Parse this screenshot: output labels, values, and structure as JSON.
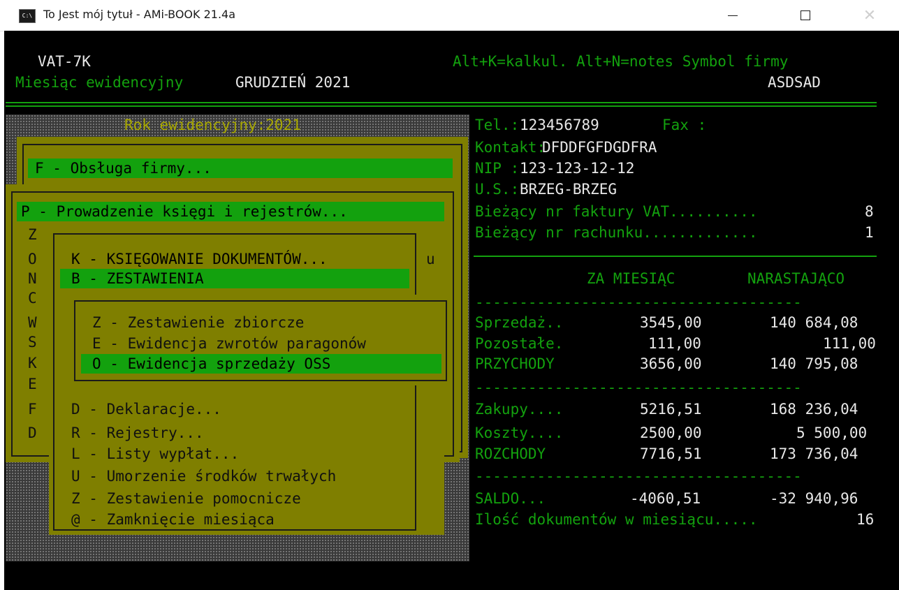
{
  "window": {
    "icon_label": "C:\\",
    "title": "To Jest mój tytuł - AMi-BOOK 21.4a"
  },
  "header": {
    "form": "VAT-7K",
    "hint": "Alt+K=kalkul. Alt+N=notes Symbol firmy",
    "month_label": "Miesiąc ewidencyjny",
    "month_value": "GRUDZIEŃ 2021",
    "symbol": "ASDSAD"
  },
  "year_label": "Rok ewidencyjny:2021",
  "info": {
    "tel_label": "Tel.:",
    "tel_value": "123456789",
    "fax_label": "Fax :",
    "contact_label": "Kontakt:",
    "contact_value": "DFDDFGFDGDFRA",
    "nip_label": "NIP :",
    "nip_value": "123-123-12-12",
    "us_label": "U.S.:",
    "us_value": "BRZEG-BRZEG",
    "invoice_label": "Bieżący nr faktury VAT..........",
    "invoice_value": "8",
    "bill_label": "Bieżący nr rachunku.............",
    "bill_value": "1"
  },
  "summary": {
    "col_month": "ZA MIESIĄC",
    "col_cumulative": "NARASTAJĄCO",
    "separator": "-------------------------------------",
    "rows": [
      {
        "label": "Sprzedaż..",
        "month": "3545,00",
        "cum": "140 684,08"
      },
      {
        "label": "Pozostałe.",
        "month": "111,00",
        "cum": "111,00"
      },
      {
        "label": "PRZYCHODY",
        "month": "3656,00",
        "cum": "140 795,08"
      },
      {
        "label": "Zakupy....",
        "month": "5216,51",
        "cum": "168 236,04"
      },
      {
        "label": "Koszty....",
        "month": "2500,00",
        "cum": "5 500,00"
      },
      {
        "label": "ROZCHODY",
        "month": "7716,51",
        "cum": "173 736,04"
      },
      {
        "label": "SALDO...",
        "month": "-4060,51",
        "cum": "-32 940,96"
      }
    ],
    "doc_count_label": "Ilość dokumentów w miesiącu.....",
    "doc_count_value": "16"
  },
  "menu1": {
    "item": "F - Obsługa firmy..."
  },
  "menu2": {
    "item": "P - Prowadzenie księgi i rejestrów...",
    "letters": [
      "Z",
      "O",
      "N",
      "C",
      "W",
      "S",
      "K",
      "E",
      "F",
      "D"
    ]
  },
  "menu3": {
    "right_letter": "u",
    "items": [
      "K - KSIĘGOWANIE DOKUMENTÓW...",
      "B - ZESTAWIENIA",
      "D - Deklaracje...",
      "R - Rejestry...",
      "L - Listy wypłat...",
      "U - Umorzenie środków trwałych",
      "Z - Zestawienie pomocnicze",
      "@ - Zamknięcie miesiąca"
    ]
  },
  "menu4": {
    "items": [
      "Z - Zestawienie zbiorcze",
      "E - Ewidencja zwrotów paragonów",
      "O - Ewidencja sprzedaży OSS"
    ]
  }
}
